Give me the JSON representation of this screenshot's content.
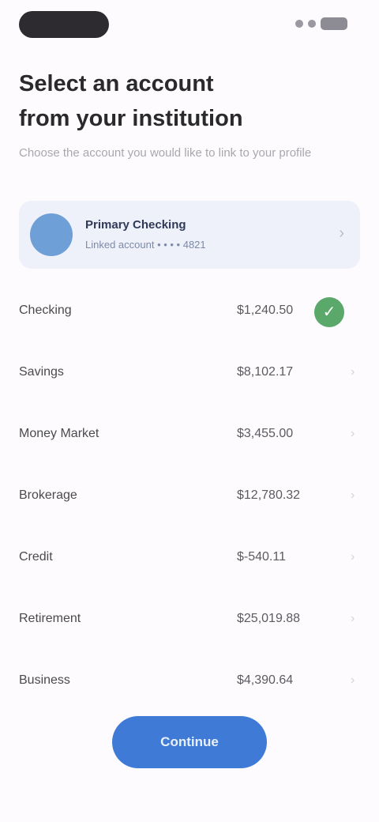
{
  "status": {
    "icons": [
      "signal-icon",
      "wifi-icon",
      "battery-icon"
    ]
  },
  "header": {
    "title": "Select an account\nfrom your institution",
    "subtitle": "Choose the account you would like to link to your profile"
  },
  "selected_account": {
    "icon": "bank-icon",
    "title": "Primary Checking",
    "subtitle": "Linked account • • • • 4821",
    "chevron": "chevron-right-icon"
  },
  "accounts": [
    {
      "label": "Checking",
      "value": "$1,240.50",
      "selected": true
    },
    {
      "label": "Savings",
      "value": "$8,102.17",
      "selected": false
    },
    {
      "label": "Money Market",
      "value": "$3,455.00",
      "selected": false
    },
    {
      "label": "Brokerage",
      "value": "$12,780.32",
      "selected": false
    },
    {
      "label": "Credit",
      "value": "$-540.11",
      "selected": false
    },
    {
      "label": "Retirement",
      "value": "$25,019.88",
      "selected": false
    },
    {
      "label": "Business",
      "value": "$4,390.64",
      "selected": false
    }
  ],
  "footer": {
    "continue_label": "Continue"
  },
  "colors": {
    "accent": "#3f7bd6",
    "selected": "#5aa86a",
    "card_bg": "#eef1fa"
  }
}
